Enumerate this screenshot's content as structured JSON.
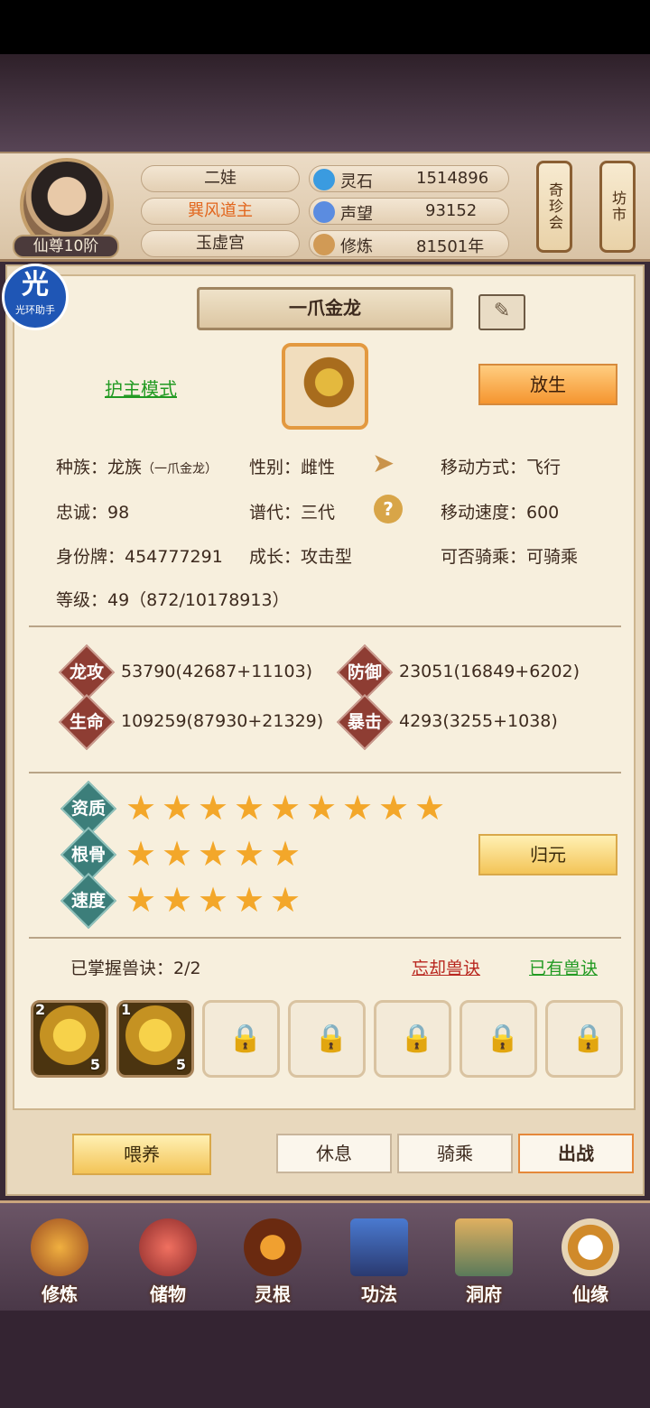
{
  "header": {
    "rank": "仙尊10阶",
    "names": [
      "二娃",
      "巽风道主",
      "玉虚宫"
    ],
    "stats": [
      {
        "label": "灵石",
        "value": "1514896",
        "icon": "spirit-stone-icon",
        "color": "#3a9be0"
      },
      {
        "label": "声望",
        "value": "93152",
        "icon": "reputation-crystal-icon",
        "color": "#5b8ce0"
      },
      {
        "label": "修炼",
        "value": "81501年",
        "icon": "meditation-icon",
        "color": "#d19a55"
      }
    ],
    "shop_buttons": [
      "奇珍会",
      "坊市"
    ]
  },
  "helper_badge": {
    "char": "光",
    "text": "光环助手"
  },
  "pet": {
    "name": "一爪金龙",
    "mode_link": "护主模式",
    "release_button": "放生",
    "info": {
      "race": "种族：龙族",
      "race_sub": "（一爪金龙）",
      "gender": "性别：雌性",
      "move_type": "移动方式：飞行",
      "loyalty": "忠诚：98",
      "generation": "谱代：三代",
      "move_speed": "移动速度：600",
      "id_tag": "身份牌：454777291",
      "growth": "成长：攻击型",
      "rideable": "可否骑乘：可骑乘",
      "level": "等级：49（872/10178913）"
    },
    "attrs": [
      {
        "tag": "龙攻",
        "value": "53790(42687+11103)"
      },
      {
        "tag": "防御",
        "value": "23051(16849+6202)"
      },
      {
        "tag": "生命",
        "value": "109259(87930+21329)"
      },
      {
        "tag": "暴击",
        "value": "4293(3255+1038)"
      }
    ],
    "quality": [
      {
        "tag": "资质",
        "stars": 9
      },
      {
        "tag": "根骨",
        "stars": 5
      },
      {
        "tag": "速度",
        "stars": 5
      }
    ],
    "reset_button": "归元",
    "skills_mastered": "已掌握兽诀：2/2",
    "forget_link": "忘却兽诀",
    "owned_link": "已有兽诀",
    "skill_slots": [
      {
        "level": "2",
        "count": "5"
      },
      {
        "level": "1",
        "count": "5"
      }
    ],
    "locked_slots": 5
  },
  "actions": {
    "feed": "喂养",
    "tabs": [
      "休息",
      "骑乘",
      "出战"
    ]
  },
  "nav": [
    "修炼",
    "储物",
    "灵根",
    "功法",
    "洞府",
    "仙缘"
  ]
}
